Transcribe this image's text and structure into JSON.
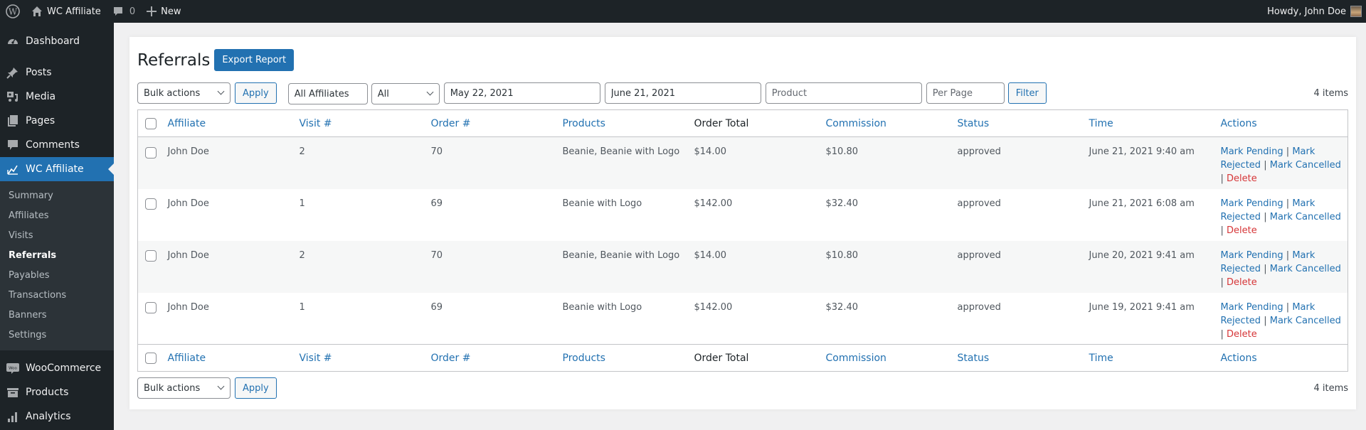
{
  "adminbar": {
    "site_name": "WC Affiliate",
    "comments_count": "0",
    "new_label": "New",
    "greeting": "Howdy, John Doe"
  },
  "sidebar": {
    "items": [
      {
        "label": "Dashboard",
        "icon": "dashboard-icon"
      },
      {
        "label": "Posts",
        "icon": "pin-icon"
      },
      {
        "label": "Media",
        "icon": "media-icon"
      },
      {
        "label": "Pages",
        "icon": "pages-icon"
      },
      {
        "label": "Comments",
        "icon": "comment-icon"
      },
      {
        "label": "WC Affiliate",
        "icon": "chart-line-icon",
        "active": true
      }
    ],
    "submenu": [
      "Summary",
      "Affiliates",
      "Visits",
      "Referrals",
      "Payables",
      "Transactions",
      "Banners",
      "Settings"
    ],
    "submenu_current": "Referrals",
    "bottom_items": [
      {
        "label": "WooCommerce",
        "icon": "woo-icon"
      },
      {
        "label": "Products",
        "icon": "archive-icon"
      },
      {
        "label": "Analytics",
        "icon": "bar-chart-icon"
      }
    ]
  },
  "page": {
    "title": "Referrals",
    "export_label": "Export Report"
  },
  "filters": {
    "bulk_actions": "Bulk actions",
    "apply_label": "Apply",
    "affiliate_select": "All Affiliates",
    "status_select": "All",
    "date_from": "May 22, 2021",
    "date_to": "June 21, 2021",
    "product_placeholder": "Product",
    "per_page_placeholder": "Per Page",
    "filter_label": "Filter",
    "items_count": "4 items"
  },
  "table": {
    "columns": [
      "Affiliate",
      "Visit #",
      "Order #",
      "Products",
      "Order Total",
      "Commission",
      "Status",
      "Time",
      "Actions"
    ],
    "rows": [
      {
        "affiliate": "John Doe",
        "visit": "2",
        "order": "70",
        "products": "Beanie, Beanie with Logo",
        "total": "$14.00",
        "commission": "$10.80",
        "status": "approved",
        "time": "June 21, 2021 9:40 am"
      },
      {
        "affiliate": "John Doe",
        "visit": "1",
        "order": "69",
        "products": "Beanie with Logo",
        "total": "$142.00",
        "commission": "$32.40",
        "status": "approved",
        "time": "June 21, 2021 6:08 am"
      },
      {
        "affiliate": "John Doe",
        "visit": "2",
        "order": "70",
        "products": "Beanie, Beanie with Logo",
        "total": "$14.00",
        "commission": "$10.80",
        "status": "approved",
        "time": "June 20, 2021 9:41 am"
      },
      {
        "affiliate": "John Doe",
        "visit": "1",
        "order": "69",
        "products": "Beanie with Logo",
        "total": "$142.00",
        "commission": "$32.40",
        "status": "approved",
        "time": "June 19, 2021 9:41 am"
      }
    ],
    "actions": {
      "mark_pending": "Mark Pending",
      "mark_rejected": "Mark Rejected",
      "mark_cancelled": "Mark Cancelled",
      "delete": "Delete",
      "separator": "|"
    }
  },
  "colors": {
    "accent": "#2271b1",
    "admin_dark": "#1d2327",
    "delete": "#d63638"
  }
}
